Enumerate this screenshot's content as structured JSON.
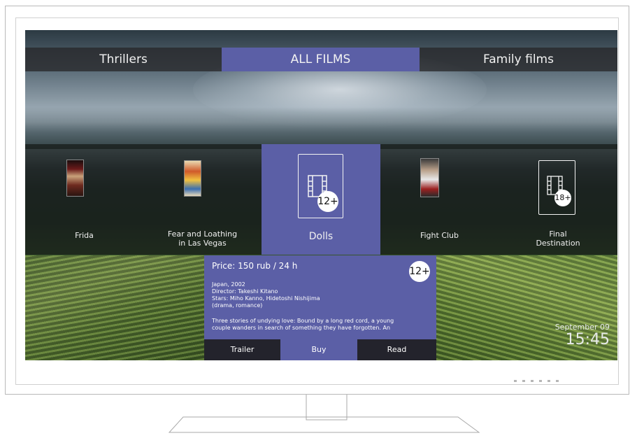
{
  "nav": {
    "tabs": [
      {
        "label": "Thrillers"
      },
      {
        "label": "ALL FILMS",
        "active": true
      },
      {
        "label": "Family films"
      }
    ]
  },
  "movies": [
    {
      "title": "Frida"
    },
    {
      "title_line1": "Fear and Loathing",
      "title_line2": "in Las Vegas"
    },
    {
      "title": "Dolls",
      "selected": true,
      "age": "12+"
    },
    {
      "title": "Fight Club"
    },
    {
      "title_line1": "Final",
      "title_line2": "Destination",
      "age": "18+"
    }
  ],
  "details": {
    "price": "Price: 150 rub / 24 h",
    "age": "12+",
    "meta": [
      "Japan, 2002",
      "Director: Takeshi Kitano",
      "Stars:  Miho Kanno, Hidetoshi Nishijima",
      "(drama, romance)"
    ],
    "description_line1": "Three stories of undying love: Bound by a long red cord, a young",
    "description_line2": "couple wanders in search of something they have forgotten. An",
    "buttons": {
      "trailer": "Trailer",
      "buy": "Buy",
      "read": "Read"
    }
  },
  "clock": {
    "date": "September 09",
    "time": "15:45"
  },
  "colors": {
    "accent": "#5b5fa6",
    "nav_bar": "#28282a"
  }
}
